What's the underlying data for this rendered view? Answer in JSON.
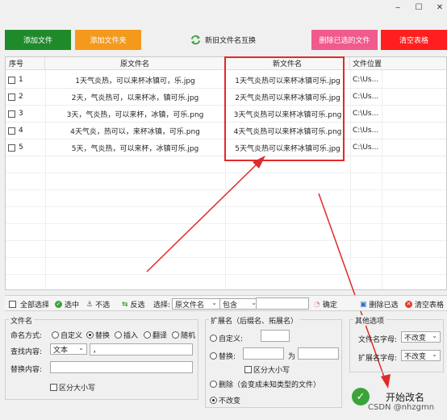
{
  "window": {
    "minimize": "‒",
    "maximize": "☐",
    "close": "✕"
  },
  "toolbar": {
    "add_file": "添加文件",
    "add_folder": "添加文件夹",
    "swap_names": "新旧文件名互换",
    "delete_selected": "删除已选的文件",
    "clear_table": "清空表格"
  },
  "colors": {
    "add_file": "#1f8a2a",
    "add_folder": "#f39a1d",
    "delete_selected": "#f05a8c",
    "clear_table": "#ff1f1f",
    "highlight": "#e02a2a"
  },
  "table": {
    "headers": {
      "index": "序号",
      "old_name": "原文件名",
      "new_name": "新文件名",
      "location": "文件位置"
    },
    "rows": [
      {
        "index": "1",
        "old_name": "1天气炎热，可以来杯冰镇可，乐.jpg",
        "new_name": "1天气炎热可以来杯冰镇可乐.jpg",
        "location": "C:\\Us..."
      },
      {
        "index": "2",
        "old_name": "2天，气炎热可，以来杯冰，镇可乐.jpg",
        "new_name": "2天气炎热可以来杯冰镇可乐.jpg",
        "location": "C:\\Us..."
      },
      {
        "index": "3",
        "old_name": "3天，气炎热，可以来杯，冰镇，可乐.png",
        "new_name": "3天气炎热可以来杯冰镇可乐.png",
        "location": "C:\\Us..."
      },
      {
        "index": "4",
        "old_name": "4天气炎，热可以，来杯冰镇，可乐.png",
        "new_name": "4天气炎热可以来杯冰镇可乐.png",
        "location": "C:\\Us..."
      },
      {
        "index": "5",
        "old_name": "5天，气炎热，可以来杯，冰镇可乐.jpg",
        "new_name": "5天气炎热可以来杯冰镇可乐.jpg",
        "location": "C:\\Us..."
      }
    ]
  },
  "actions": {
    "select_all": "全部选择",
    "check": "选中",
    "uncheck": "不选",
    "invert": "反选",
    "select_label": "选择:",
    "select_field": "原文件名",
    "select_mode": "包含",
    "select_value": "",
    "confirm": "确定",
    "delete_checked": "删除已选",
    "clear_table": "清空表格"
  },
  "filename_group": {
    "legend": "文件名",
    "naming_mode_label": "命名方式:",
    "modes": [
      "自定义",
      "替换",
      "插入",
      "翻译",
      "随机"
    ],
    "find_label": "查找内容:",
    "find_type": "文本",
    "find_value": "，",
    "replace_label": "替换内容:",
    "replace_value": "",
    "case_sensitive": "区分大小写"
  },
  "ext_group": {
    "legend": "扩展名（后缀名、拓展名）",
    "custom": "自定义:",
    "replace": "替换:",
    "replace_to": "为",
    "case_sensitive": "区分大小写",
    "delete": "删除（会变成未知类型的文件）",
    "unchanged": "不改变"
  },
  "other_group": {
    "legend": "其他选项",
    "filename_case_label": "文件名字母:",
    "filename_case_value": "不改变",
    "ext_case_label": "扩展名字母:",
    "ext_case_value": "不改变"
  },
  "start": {
    "label": "开始改名"
  },
  "watermark": "CSDN @nhzgmn"
}
